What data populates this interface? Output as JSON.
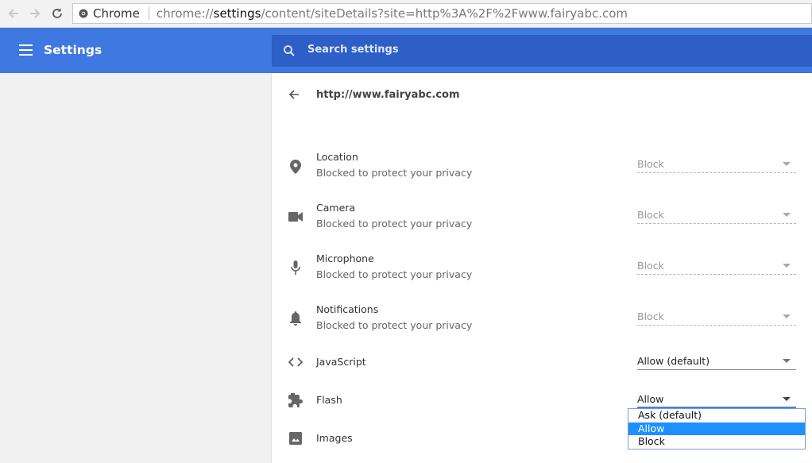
{
  "browser": {
    "chip_label": "Chrome",
    "url_prefix": "chrome://",
    "url_host": "settings",
    "url_rest": "/content/siteDetails?site=http%3A%2F%2Fwww.fairyabc.com"
  },
  "header": {
    "title": "Settings",
    "search_placeholder": "Search settings",
    "accent_color": "#3f78e0"
  },
  "site": {
    "title": "http://www.fairyabc.com"
  },
  "permissions": [
    {
      "label": "Location",
      "sub": "Blocked to protect your privacy",
      "value": "Block",
      "icon": "location-pin-icon",
      "enabled": false
    },
    {
      "label": "Camera",
      "sub": "Blocked to protect your privacy",
      "value": "Block",
      "icon": "camera-icon",
      "enabled": false
    },
    {
      "label": "Microphone",
      "sub": "Blocked to protect your privacy",
      "value": "Block",
      "icon": "microphone-icon",
      "enabled": false
    },
    {
      "label": "Notifications",
      "sub": "Blocked to protect your privacy",
      "value": "Block",
      "icon": "bell-icon",
      "enabled": false
    },
    {
      "label": "JavaScript",
      "sub": "",
      "value": "Allow (default)",
      "icon": "code-icon",
      "enabled": true
    },
    {
      "label": "Flash",
      "sub": "",
      "value": "Allow",
      "icon": "puzzle-icon",
      "enabled": true
    },
    {
      "label": "Images",
      "sub": "",
      "value": "",
      "icon": "image-icon",
      "enabled": true
    }
  ],
  "flash_dropdown": {
    "options": [
      "Ask (default)",
      "Allow",
      "Block"
    ],
    "selected": "Allow"
  }
}
